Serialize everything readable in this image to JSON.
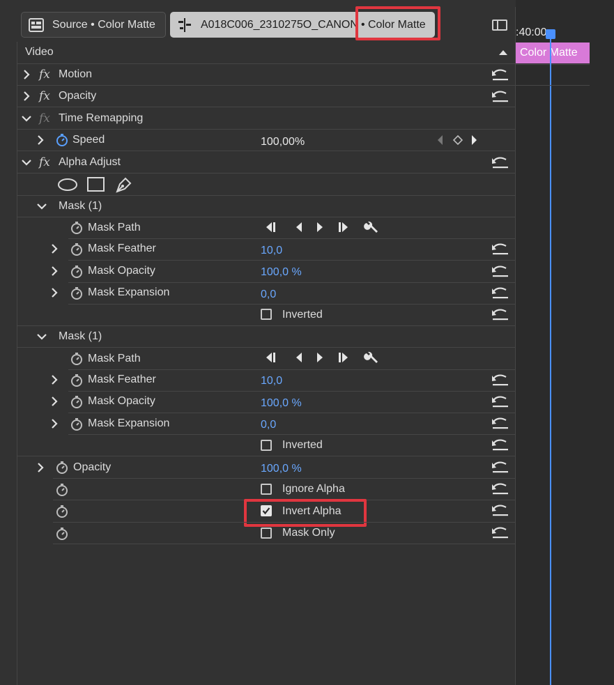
{
  "tabs": {
    "source_label": "Source • Color Matte",
    "sequence_label": "A018C006_2310275O_CANON",
    "sequence_suffix": "• Color Matte"
  },
  "timeline": {
    "timecode": ":40:00",
    "clip_label": "Color Matte",
    "clip_color": "#d87ad8",
    "playhead_color": "#4a90ff"
  },
  "section": {
    "label": "Video"
  },
  "effects": {
    "motion": "Motion",
    "opacity": "Opacity",
    "time_remapping": "Time Remapping",
    "speed_label": "Speed",
    "speed_value": "100,00%",
    "alpha_adjust": "Alpha Adjust"
  },
  "mask1": {
    "title": "Mask (1)",
    "path": "Mask Path",
    "feather": "Mask Feather",
    "feather_value": "10,0",
    "opacity": "Mask Opacity",
    "opacity_value": "100,0 %",
    "expansion": "Mask Expansion",
    "expansion_value": "0,0",
    "inverted": "Inverted"
  },
  "mask2": {
    "title": "Mask (1)",
    "path": "Mask Path",
    "feather": "Mask Feather",
    "feather_value": "10,0",
    "opacity": "Mask Opacity",
    "opacity_value": "100,0 %",
    "expansion": "Mask Expansion",
    "expansion_value": "0,0",
    "inverted": "Inverted"
  },
  "alpha": {
    "opacity_label": "Opacity",
    "opacity_value": "100,0 %",
    "ignore_alpha": "Ignore Alpha",
    "invert_alpha": "Invert Alpha",
    "invert_alpha_checked": true,
    "mask_only": "Mask Only"
  },
  "colors": {
    "highlight": "#e0363f",
    "value_blue": "#6aa8ff"
  }
}
